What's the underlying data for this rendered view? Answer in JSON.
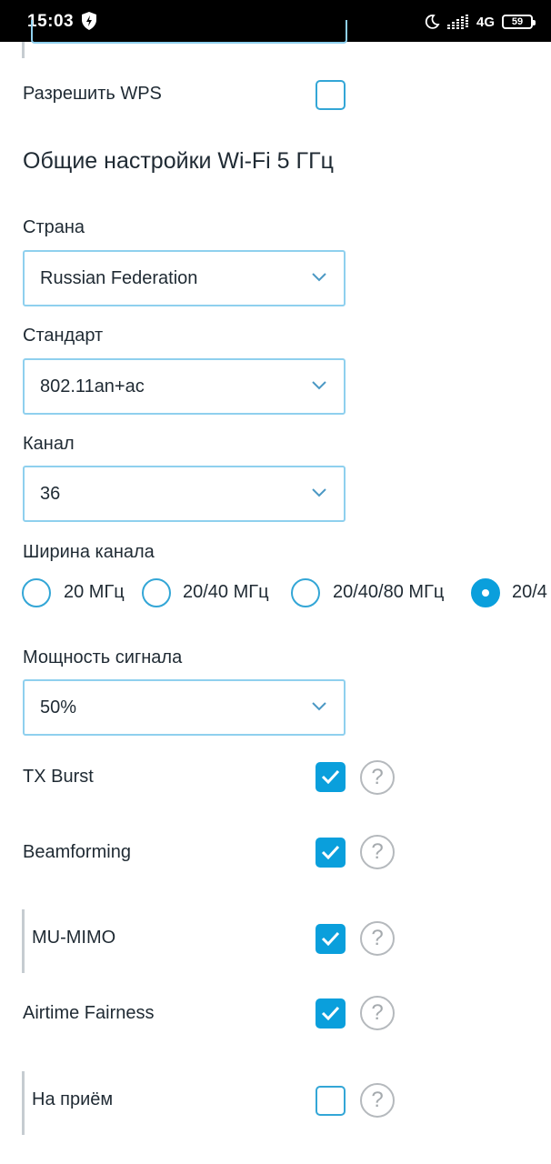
{
  "status_bar": {
    "time": "15:03",
    "network": "4G",
    "battery": "59",
    "icons": [
      "shield-bolt-icon",
      "moon-icon",
      "signal-icon",
      "battery-icon"
    ]
  },
  "wps": {
    "label": "Разрешить WPS",
    "checked": false
  },
  "section_title": "Общие настройки Wi-Fi 5 ГГц",
  "country": {
    "label": "Страна",
    "value": "Russian Federation"
  },
  "standard": {
    "label": "Стандарт",
    "value": "802.11an+ac"
  },
  "channel": {
    "label": "Канал",
    "value": "36"
  },
  "bandwidth": {
    "label": "Ширина канала",
    "options": [
      {
        "label": "20 МГц",
        "selected": false
      },
      {
        "label": "20/40 МГц",
        "selected": false
      },
      {
        "label": "20/40/80 МГц",
        "selected": false
      },
      {
        "label": "20/4",
        "selected": true
      }
    ]
  },
  "tx_power": {
    "label": "Мощность сигнала",
    "value": "50%"
  },
  "options": [
    {
      "label": "TX Burst",
      "checked": true
    },
    {
      "label": "Beamforming",
      "checked": true
    },
    {
      "label": "MU-MIMO",
      "checked": true
    },
    {
      "label": "Airtime Fairness",
      "checked": true
    },
    {
      "label": "На приём",
      "checked": false
    }
  ],
  "help_glyph": "?",
  "colors": {
    "accent": "#0a9fdc",
    "field_border": "#8fd0ee",
    "text": "#1f2a33",
    "help": "#b5b9bd",
    "status_bar": "#000000"
  }
}
